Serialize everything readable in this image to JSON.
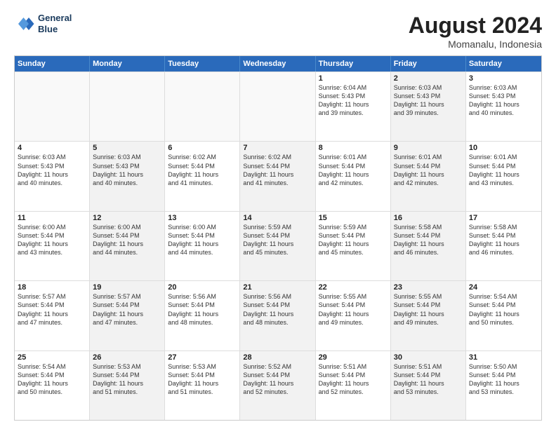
{
  "logo": {
    "line1": "General",
    "line2": "Blue"
  },
  "title": "August 2024",
  "subtitle": "Momanalu, Indonesia",
  "weekdays": [
    "Sunday",
    "Monday",
    "Tuesday",
    "Wednesday",
    "Thursday",
    "Friday",
    "Saturday"
  ],
  "rows": [
    [
      {
        "day": "",
        "text": "",
        "empty": true
      },
      {
        "day": "",
        "text": "",
        "empty": true
      },
      {
        "day": "",
        "text": "",
        "empty": true
      },
      {
        "day": "",
        "text": "",
        "empty": true
      },
      {
        "day": "1",
        "text": "Sunrise: 6:04 AM\nSunset: 5:43 PM\nDaylight: 11 hours\nand 39 minutes.",
        "shaded": false
      },
      {
        "day": "2",
        "text": "Sunrise: 6:03 AM\nSunset: 5:43 PM\nDaylight: 11 hours\nand 39 minutes.",
        "shaded": true
      },
      {
        "day": "3",
        "text": "Sunrise: 6:03 AM\nSunset: 5:43 PM\nDaylight: 11 hours\nand 40 minutes.",
        "shaded": false
      }
    ],
    [
      {
        "day": "4",
        "text": "Sunrise: 6:03 AM\nSunset: 5:43 PM\nDaylight: 11 hours\nand 40 minutes.",
        "shaded": false
      },
      {
        "day": "5",
        "text": "Sunrise: 6:03 AM\nSunset: 5:43 PM\nDaylight: 11 hours\nand 40 minutes.",
        "shaded": true
      },
      {
        "day": "6",
        "text": "Sunrise: 6:02 AM\nSunset: 5:44 PM\nDaylight: 11 hours\nand 41 minutes.",
        "shaded": false
      },
      {
        "day": "7",
        "text": "Sunrise: 6:02 AM\nSunset: 5:44 PM\nDaylight: 11 hours\nand 41 minutes.",
        "shaded": true
      },
      {
        "day": "8",
        "text": "Sunrise: 6:01 AM\nSunset: 5:44 PM\nDaylight: 11 hours\nand 42 minutes.",
        "shaded": false
      },
      {
        "day": "9",
        "text": "Sunrise: 6:01 AM\nSunset: 5:44 PM\nDaylight: 11 hours\nand 42 minutes.",
        "shaded": true
      },
      {
        "day": "10",
        "text": "Sunrise: 6:01 AM\nSunset: 5:44 PM\nDaylight: 11 hours\nand 43 minutes.",
        "shaded": false
      }
    ],
    [
      {
        "day": "11",
        "text": "Sunrise: 6:00 AM\nSunset: 5:44 PM\nDaylight: 11 hours\nand 43 minutes.",
        "shaded": false
      },
      {
        "day": "12",
        "text": "Sunrise: 6:00 AM\nSunset: 5:44 PM\nDaylight: 11 hours\nand 44 minutes.",
        "shaded": true
      },
      {
        "day": "13",
        "text": "Sunrise: 6:00 AM\nSunset: 5:44 PM\nDaylight: 11 hours\nand 44 minutes.",
        "shaded": false
      },
      {
        "day": "14",
        "text": "Sunrise: 5:59 AM\nSunset: 5:44 PM\nDaylight: 11 hours\nand 45 minutes.",
        "shaded": true
      },
      {
        "day": "15",
        "text": "Sunrise: 5:59 AM\nSunset: 5:44 PM\nDaylight: 11 hours\nand 45 minutes.",
        "shaded": false
      },
      {
        "day": "16",
        "text": "Sunrise: 5:58 AM\nSunset: 5:44 PM\nDaylight: 11 hours\nand 46 minutes.",
        "shaded": true
      },
      {
        "day": "17",
        "text": "Sunrise: 5:58 AM\nSunset: 5:44 PM\nDaylight: 11 hours\nand 46 minutes.",
        "shaded": false
      }
    ],
    [
      {
        "day": "18",
        "text": "Sunrise: 5:57 AM\nSunset: 5:44 PM\nDaylight: 11 hours\nand 47 minutes.",
        "shaded": false
      },
      {
        "day": "19",
        "text": "Sunrise: 5:57 AM\nSunset: 5:44 PM\nDaylight: 11 hours\nand 47 minutes.",
        "shaded": true
      },
      {
        "day": "20",
        "text": "Sunrise: 5:56 AM\nSunset: 5:44 PM\nDaylight: 11 hours\nand 48 minutes.",
        "shaded": false
      },
      {
        "day": "21",
        "text": "Sunrise: 5:56 AM\nSunset: 5:44 PM\nDaylight: 11 hours\nand 48 minutes.",
        "shaded": true
      },
      {
        "day": "22",
        "text": "Sunrise: 5:55 AM\nSunset: 5:44 PM\nDaylight: 11 hours\nand 49 minutes.",
        "shaded": false
      },
      {
        "day": "23",
        "text": "Sunrise: 5:55 AM\nSunset: 5:44 PM\nDaylight: 11 hours\nand 49 minutes.",
        "shaded": true
      },
      {
        "day": "24",
        "text": "Sunrise: 5:54 AM\nSunset: 5:44 PM\nDaylight: 11 hours\nand 50 minutes.",
        "shaded": false
      }
    ],
    [
      {
        "day": "25",
        "text": "Sunrise: 5:54 AM\nSunset: 5:44 PM\nDaylight: 11 hours\nand 50 minutes.",
        "shaded": false
      },
      {
        "day": "26",
        "text": "Sunrise: 5:53 AM\nSunset: 5:44 PM\nDaylight: 11 hours\nand 51 minutes.",
        "shaded": true
      },
      {
        "day": "27",
        "text": "Sunrise: 5:53 AM\nSunset: 5:44 PM\nDaylight: 11 hours\nand 51 minutes.",
        "shaded": false
      },
      {
        "day": "28",
        "text": "Sunrise: 5:52 AM\nSunset: 5:44 PM\nDaylight: 11 hours\nand 52 minutes.",
        "shaded": true
      },
      {
        "day": "29",
        "text": "Sunrise: 5:51 AM\nSunset: 5:44 PM\nDaylight: 11 hours\nand 52 minutes.",
        "shaded": false
      },
      {
        "day": "30",
        "text": "Sunrise: 5:51 AM\nSunset: 5:44 PM\nDaylight: 11 hours\nand 53 minutes.",
        "shaded": true
      },
      {
        "day": "31",
        "text": "Sunrise: 5:50 AM\nSunset: 5:44 PM\nDaylight: 11 hours\nand 53 minutes.",
        "shaded": false
      }
    ]
  ]
}
